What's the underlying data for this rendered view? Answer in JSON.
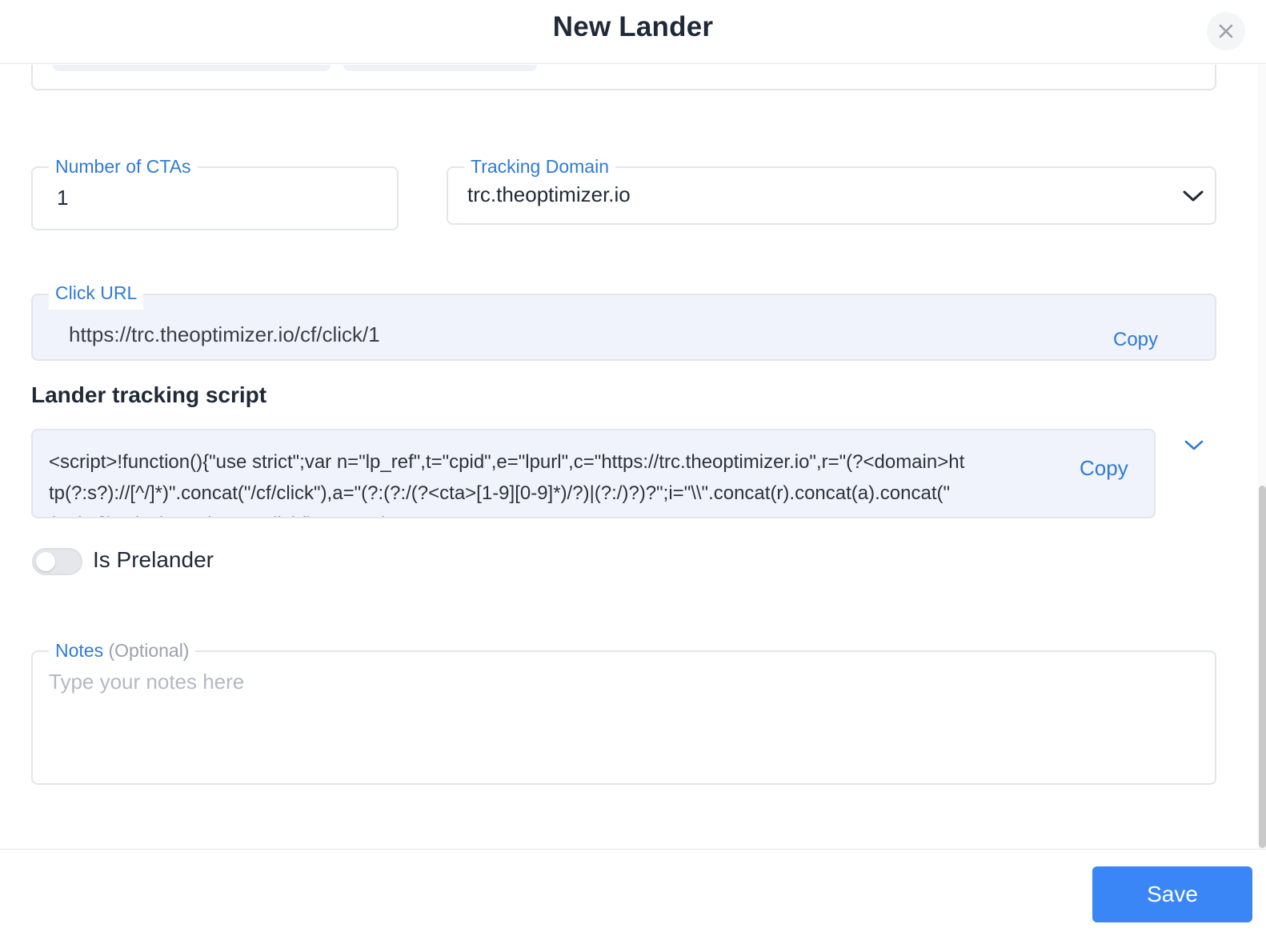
{
  "modal": {
    "title": "New Lander",
    "close_icon": "close-icon"
  },
  "ctas": {
    "label": "Number of CTAs",
    "value": "1"
  },
  "tracking_domain": {
    "label": "Tracking Domain",
    "value": "trc.theoptimizer.io",
    "icon": "chevron-down-icon"
  },
  "click_url": {
    "label": "Click URL",
    "value": "https://trc.theoptimizer.io/cf/click/1",
    "copy_label": "Copy"
  },
  "tracking_script": {
    "title": "Lander tracking script",
    "code": "<script>!function(){\"use strict\";var n=\"lp_ref\",t=\"cpid\",e=\"lpurl\",c=\"https://trc.theoptimizer.io\",r=\"(?<domain>http(?:s?)://[^/]*)\".concat(\"/cf/click\"),a=\"(?:(?:/(?<cta>[1-9][0-9]*)/?)|(?:/)?)?\";i=\"\\\\\".concat(r).concat(a).concat(\"(?.*)?(\\\\?.*)?\")\";o=\"lp\",u=\"clickflare\",s=\"(?",
    "copy_label": "Copy",
    "expand_icon": "chevron-down-icon"
  },
  "prelander": {
    "label": "Is Prelander",
    "enabled": false
  },
  "notes": {
    "label": "Notes",
    "optional_label": "(Optional)",
    "placeholder": "Type your notes here",
    "value": ""
  },
  "footer": {
    "save_label": "Save"
  },
  "colors": {
    "accent": "#2f7bd6",
    "primary_button": "#3a86f7",
    "readonly_bg": "#f0f3fb"
  }
}
